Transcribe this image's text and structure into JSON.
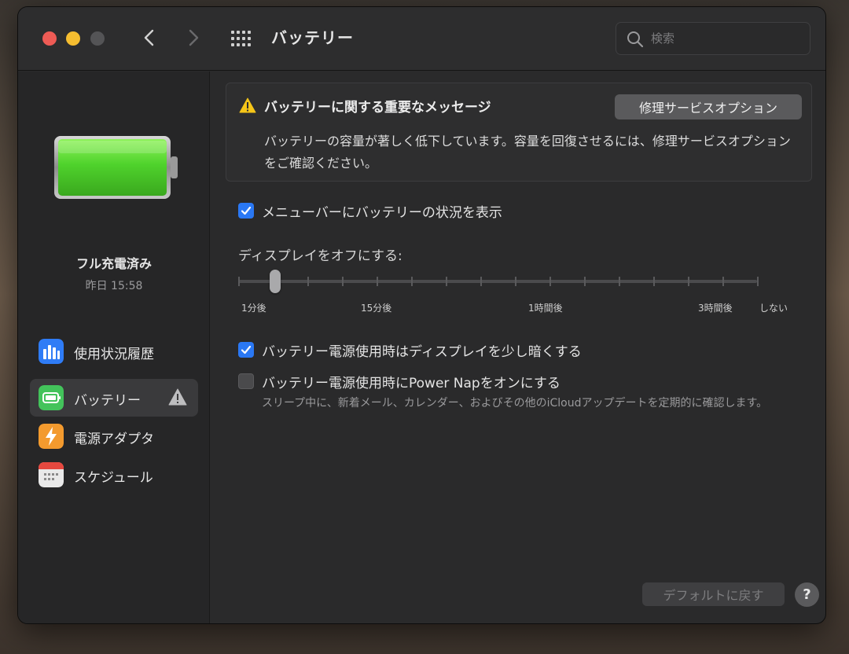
{
  "window": {
    "title": "バッテリー",
    "search_placeholder": "検索"
  },
  "sidebar": {
    "status": "フル充電済み",
    "timestamp": "昨日 15:58",
    "battery_level": 1.0,
    "items": [
      {
        "label": "使用状況履歴",
        "icon": "bar-chart-icon",
        "color": "#2f7cf6"
      },
      {
        "label": "バッテリー",
        "icon": "battery-icon",
        "color": "#43c35b",
        "active": true,
        "warning": true
      },
      {
        "label": "電源アダプタ",
        "icon": "lightning-bolt-icon",
        "color": "#f39a2e"
      },
      {
        "label": "スケジュール",
        "icon": "calendar-icon",
        "color": "#e9e9e9"
      }
    ]
  },
  "message": {
    "title": "バッテリーに関する重要なメッセージ",
    "button": "修理サービスオプション",
    "body": "バッテリーの容量が著しく低下しています。容量を回復させるには、修理サービスオプションをご確認ください。"
  },
  "options": {
    "menubar_status": {
      "label": "メニューバーにバッテリーの状況を表示",
      "checked": true
    },
    "display_off": {
      "label": "ディスプレイをオフにする:",
      "ticks": [
        "1分後",
        "15分後",
        "1時間後",
        "3時間後",
        "しない"
      ],
      "value": "2分後"
    },
    "dim_display": {
      "label": "バッテリー電源使用時はディスプレイを少し暗くする",
      "checked": true
    },
    "power_nap": {
      "label": "バッテリー電源使用時にPower Napをオンにする",
      "checked": false
    },
    "power_nap_desc": "スリープ中に、新着メール、カレンダー、およびその他のiCloudアップデートを定期的に確認します。"
  },
  "footer": {
    "restore_defaults": "デフォルトに戻す",
    "help": "?"
  },
  "colors": {
    "accent": "#2a78f4",
    "warning": "#f5c518",
    "battery": "#5bdc32"
  }
}
